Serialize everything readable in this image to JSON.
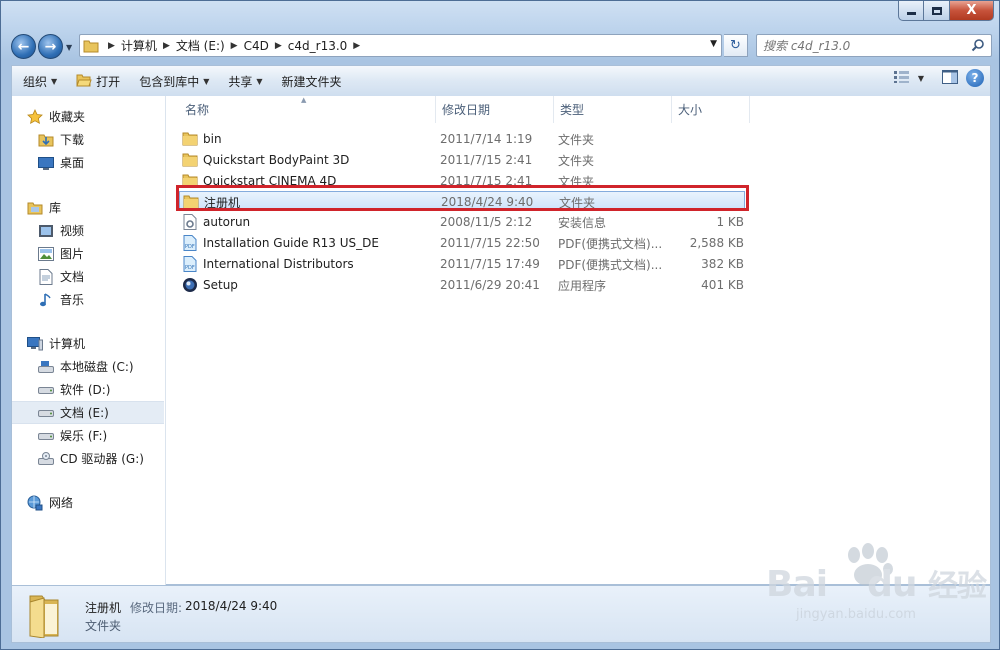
{
  "window": {
    "caption_close_glyph": "X"
  },
  "address": {
    "breadcrumbs": [
      "计算机",
      "文档 (E:)",
      "C4D",
      "c4d_r13.0"
    ]
  },
  "search": {
    "placeholder": "搜索 c4d_r13.0"
  },
  "toolbar": {
    "organize": "组织",
    "open": "打开",
    "include_in_library": "包含到库中",
    "share": "共享",
    "new_folder": "新建文件夹"
  },
  "sidebar": {
    "favorites": "收藏夹",
    "downloads": "下载",
    "desktop": "桌面",
    "libraries": "库",
    "videos": "视频",
    "pictures": "图片",
    "documents": "文档",
    "music": "音乐",
    "computer": "计算机",
    "drive_c": "本地磁盘 (C:)",
    "drive_d": "软件 (D:)",
    "drive_e": "文档 (E:)",
    "drive_f": "娱乐 (F:)",
    "drive_g": "CD 驱动器 (G:)",
    "network": "网络"
  },
  "columns": {
    "name": "名称",
    "modified": "修改日期",
    "type": "类型",
    "size": "大小"
  },
  "files": [
    {
      "name": "bin",
      "modified": "2011/7/14 1:19",
      "type": "文件夹",
      "size": "",
      "icon": "folder-icon"
    },
    {
      "name": "Quickstart BodyPaint 3D",
      "modified": "2011/7/15 2:41",
      "type": "文件夹",
      "size": "",
      "icon": "folder-icon"
    },
    {
      "name": "Quickstart CINEMA 4D",
      "modified": "2011/7/15 2:41",
      "type": "文件夹",
      "size": "",
      "icon": "folder-icon"
    },
    {
      "name": "注册机",
      "modified": "2018/4/24 9:40",
      "type": "文件夹",
      "size": "",
      "icon": "folder-icon"
    },
    {
      "name": "autorun",
      "modified": "2008/11/5 2:12",
      "type": "安装信息",
      "size": "1 KB",
      "icon": "settings-file-icon"
    },
    {
      "name": "Installation Guide R13 US_DE",
      "modified": "2011/7/15 22:50",
      "type": "PDF(便携式文档)...",
      "size": "2,588 KB",
      "icon": "pdf-icon"
    },
    {
      "name": "International Distributors",
      "modified": "2011/7/15 17:49",
      "type": "PDF(便携式文档)...",
      "size": "382 KB",
      "icon": "pdf-icon"
    },
    {
      "name": "Setup",
      "modified": "2011/6/29 20:41",
      "type": "应用程序",
      "size": "401 KB",
      "icon": "cinema4d-app-icon"
    }
  ],
  "details": {
    "name": "注册机",
    "modified_label": "修改日期:",
    "modified_value": "2018/4/24 9:40",
    "type": "文件夹"
  },
  "watermark": {
    "brand_latin": "Bai",
    "brand_latin2": "du",
    "brand_cn": "经验",
    "url": "jingyan.baidu.com"
  }
}
